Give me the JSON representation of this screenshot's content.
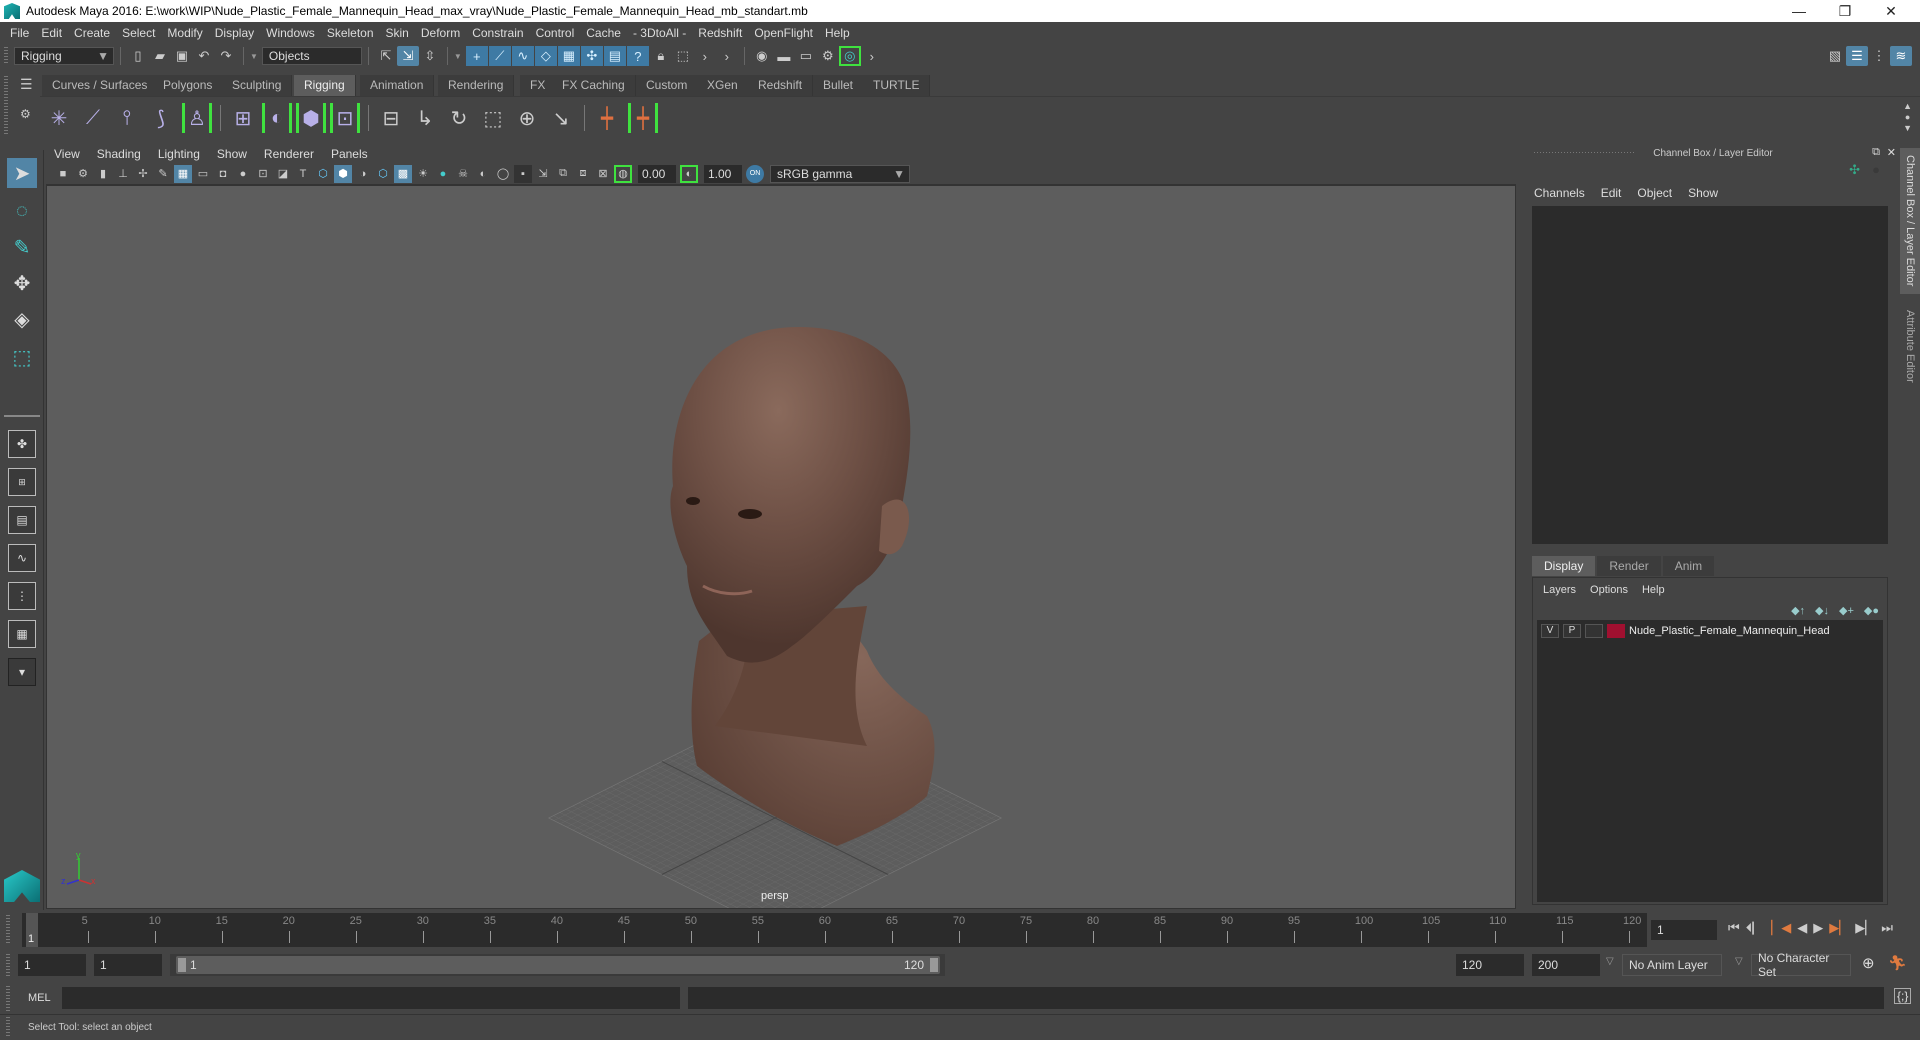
{
  "window": {
    "title": "Autodesk Maya 2016: E:\\work\\WIP\\Nude_Plastic_Female_Mannequin_Head_max_vray\\Nude_Plastic_Female_Mannequin_Head_mb_standart.mb",
    "controls": {
      "minimize": "—",
      "restore": "❐",
      "close": "✕"
    }
  },
  "menubar": [
    "File",
    "Edit",
    "Create",
    "Select",
    "Modify",
    "Display",
    "Windows",
    "Skeleton",
    "Skin",
    "Deform",
    "Constrain",
    "Control",
    "Cache",
    "- 3DtoAll -",
    "Redshift",
    "OpenFlight",
    "Help"
  ],
  "statusline": {
    "menuset": "Rigging",
    "selection_mode": "Objects"
  },
  "shelf": {
    "tabs": [
      "Curves / Surfaces",
      "Polygons",
      "Sculpting",
      "Rigging",
      "Animation",
      "Rendering",
      "FX",
      "FX Caching",
      "Custom",
      "XGen",
      "Redshift",
      "Bullet",
      "TURTLE"
    ],
    "active_tab": "Rigging",
    "icons": [
      "create-joints",
      "ik-handle",
      "ik-spline-handle",
      "insert-joint",
      "quick-rig",
      "bind-skin",
      "smooth-bind",
      "interactive-bind",
      "paint-weights",
      "parent-constraint",
      "point-constraint",
      "orient-constraint",
      "scale-constraint",
      "aim-constraint",
      "pole-vector-constraint",
      "locator",
      "locator-bracketed"
    ]
  },
  "toolbox": {
    "tools": [
      "select-tool",
      "lasso-tool",
      "paint-select-tool",
      "move-tool",
      "rotate-tool",
      "scale-tool"
    ],
    "active_tool": "select-tool"
  },
  "viewport": {
    "menu": [
      "View",
      "Shading",
      "Lighting",
      "Show",
      "Renderer",
      "Panels"
    ],
    "exposure": "0.00",
    "gamma": "1.00",
    "color_space": "sRGB gamma",
    "camera_label": "persp",
    "axis": {
      "x": "x",
      "y": "y",
      "z": "z"
    }
  },
  "channel_box": {
    "title": "Channel Box / Layer Editor",
    "menu": [
      "Channels",
      "Edit",
      "Object",
      "Show"
    ]
  },
  "layer_editor": {
    "tabs": [
      "Display",
      "Render",
      "Anim"
    ],
    "active_tab": "Display",
    "menu": [
      "Layers",
      "Options",
      "Help"
    ],
    "layers": [
      {
        "visible": "V",
        "playback": "P",
        "color": "#a01030",
        "name": "Nude_Plastic_Female_Mannequin_Head"
      }
    ]
  },
  "side_tabs": [
    "Channel Box / Layer Editor",
    "Attribute Editor"
  ],
  "timeline": {
    "ticks": [
      5,
      10,
      15,
      20,
      25,
      30,
      35,
      40,
      45,
      50,
      55,
      60,
      65,
      70,
      75,
      80,
      85,
      90,
      95,
      100,
      105,
      110,
      115,
      120
    ],
    "start": 1,
    "end": 120,
    "current_frame": "1",
    "current_frame_field": "1"
  },
  "range": {
    "start_time": "1",
    "playback_start": "1",
    "range_start_label": "1",
    "range_end_label": "120",
    "playback_end": "120",
    "end_time": "200",
    "anim_layer": "No Anim Layer",
    "character_set": "No Character Set"
  },
  "command_line": {
    "language": "MEL",
    "input": "",
    "result": ""
  },
  "help_line": "Select Tool: select an object",
  "colors": {
    "accent": "#5285a6",
    "active_key": "#e07a3f",
    "shelf_highlight": "#3fe23f"
  }
}
